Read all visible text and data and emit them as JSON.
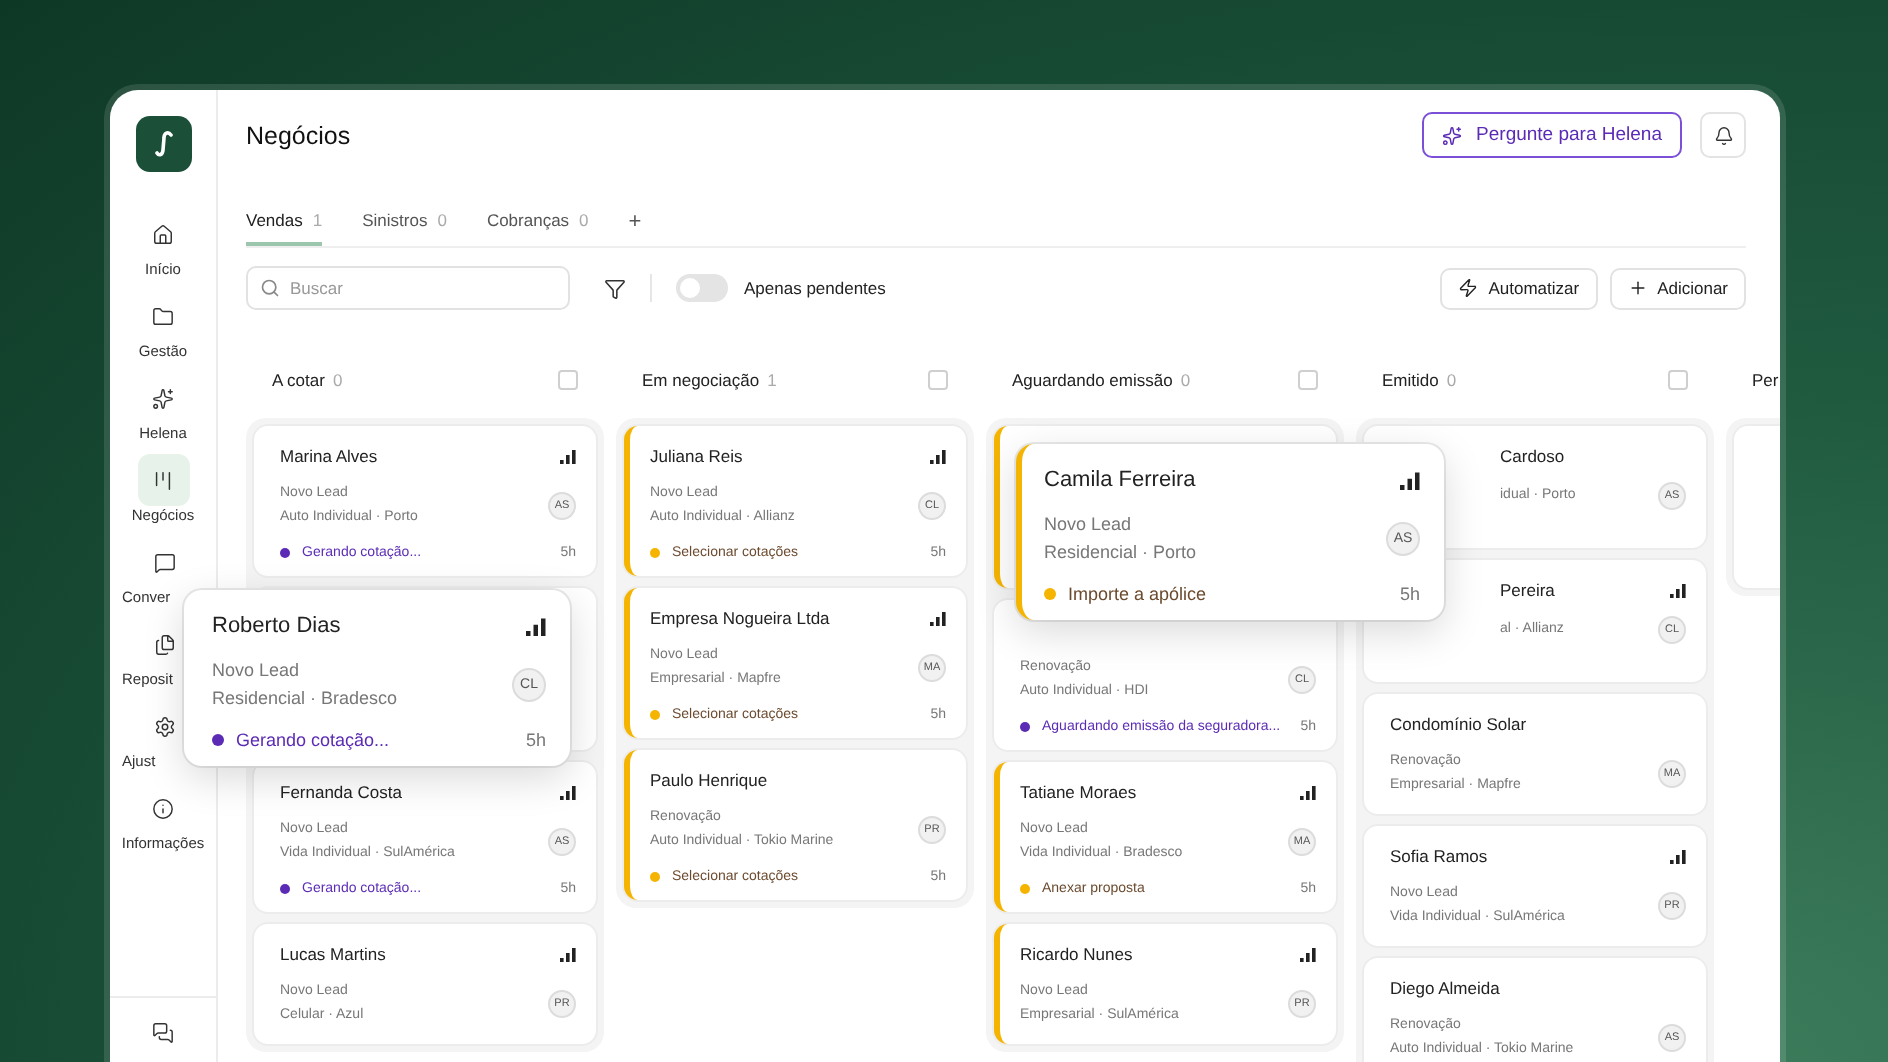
{
  "sidebar": {
    "items": [
      {
        "label": "Início",
        "kind": "nav",
        "selected": false
      },
      {
        "label": "Gestão",
        "kind": "nav",
        "selected": false
      },
      {
        "label": "Helena",
        "kind": "nav",
        "selected": false
      },
      {
        "label": "Negócios",
        "kind": "nav",
        "selected": true
      },
      {
        "label": "Conver",
        "kind": "clipped",
        "selected": false
      },
      {
        "label": "Reposit",
        "kind": "clipped",
        "selected": false
      },
      {
        "label": "Ajust",
        "kind": "clipped",
        "selected": false
      },
      {
        "label": "Informações",
        "kind": "nav",
        "selected": false
      }
    ]
  },
  "header": {
    "title": "Negócios",
    "ask_button": "Pergunte para Helena"
  },
  "tabs": [
    {
      "label": "Vendas",
      "count": "1",
      "selected": true
    },
    {
      "label": "Sinistros",
      "count": "0",
      "selected": false
    },
    {
      "label": "Cobranças",
      "count": "0",
      "selected": false
    }
  ],
  "add_tab": "+",
  "toolbar": {
    "search": {
      "placeholder": "Buscar"
    },
    "toggle": {
      "label": "Apenas pendentes",
      "on": false
    },
    "buttons": [
      "Automatizar",
      "Adicionar"
    ]
  },
  "columns": [
    {
      "title": "A cotar",
      "count": "0",
      "checked": false,
      "cards": [
        {
          "kind": "full",
          "accent": false,
          "name": "Marina Alves",
          "signal": true,
          "lines": [
            "Novo Lead",
            "Auto Individual · Porto"
          ],
          "avatar": "AS",
          "status": {
            "kind": "ai",
            "text": "Gerando cotação...",
            "color": "#5b2bb5"
          },
          "time": "5h"
        },
        {
          "kind": "covered"
        },
        {
          "kind": "full",
          "accent": false,
          "name": "Fernanda Costa",
          "signal": true,
          "lines": [
            "Novo Lead",
            "Vida Individual · SulAmérica"
          ],
          "avatar": "AS",
          "status": {
            "kind": "ai",
            "text": "Gerando cotação...",
            "color": "#5b2bb5"
          },
          "time": "5h"
        },
        {
          "kind": "full",
          "accent": false,
          "name": "Lucas Martins",
          "signal": true,
          "lines": [
            "Novo Lead",
            "Celular · Azul"
          ],
          "avatar": "PR"
        }
      ]
    },
    {
      "title": "Em negociação",
      "count": "1",
      "checked": false,
      "cards": [
        {
          "kind": "full",
          "accent": true,
          "name": "Juliana Reis",
          "signal": true,
          "lines": [
            "Novo Lead",
            "Auto Individual · Allianz"
          ],
          "avatar": "CL",
          "status": {
            "kind": "task",
            "text": "Selecionar cotações",
            "color": "#f5b400"
          },
          "time": "5h"
        },
        {
          "kind": "full",
          "accent": true,
          "name": "Empresa Nogueira Ltda",
          "signal": true,
          "lines": [
            "Novo Lead",
            "Empresarial · Mapfre"
          ],
          "avatar": "MA",
          "status": {
            "kind": "task",
            "text": "Selecionar cotações",
            "color": "#f5b400"
          },
          "time": "5h"
        },
        {
          "kind": "full",
          "accent": true,
          "name": "Paulo Henrique",
          "signal": false,
          "lines": [
            "Renovação",
            "Auto Individual · Tokio Marine"
          ],
          "avatar": "PR",
          "status": {
            "kind": "task",
            "text": "Selecionar cotações",
            "color": "#f5b400"
          },
          "time": "5h"
        }
      ]
    },
    {
      "title": "Aguardando emissão",
      "count": "0",
      "checked": false,
      "cards": [
        {
          "kind": "covered",
          "accent": true
        },
        {
          "kind": "full",
          "accent": false,
          "signal": false,
          "lines": [
            "Renovação",
            "Auto Individual · HDI"
          ],
          "avatar": "CL",
          "status": {
            "kind": "ai",
            "text": "Aguardando emissão da seguradora...",
            "color": "#5b2bb5"
          },
          "time": "5h"
        },
        {
          "kind": "full",
          "accent": true,
          "name": "Tatiane Moraes",
          "signal": true,
          "lines": [
            "Novo Lead",
            "Vida Individual · Bradesco"
          ],
          "avatar": "MA",
          "status": {
            "kind": "task",
            "text": "Anexar proposta",
            "color": "#f5b400"
          },
          "time": "5h"
        },
        {
          "kind": "full",
          "accent": true,
          "name": "Ricardo Nunes",
          "signal": true,
          "lines": [
            "Novo Lead",
            "Empresarial · SulAmérica"
          ],
          "avatar": "PR"
        }
      ]
    },
    {
      "title": "Emitido",
      "count": "0",
      "checked": false,
      "cards": [
        {
          "kind": "partial",
          "accent": false,
          "name": "Cardoso",
          "signal": false,
          "lines": [
            "idual · Porto"
          ],
          "avatar": "AS"
        },
        {
          "kind": "partial",
          "accent": false,
          "name": "Pereira",
          "signal": true,
          "lines": [
            "al · Allianz"
          ],
          "avatar": "CL"
        },
        {
          "kind": "full",
          "accent": false,
          "name": "Condomínio Solar",
          "signal": false,
          "lines": [
            "Renovação",
            "Empresarial · Mapfre"
          ],
          "avatar": "MA"
        },
        {
          "kind": "full",
          "accent": false,
          "name": "Sofia Ramos",
          "signal": true,
          "lines": [
            "Novo Lead",
            "Vida Individual · SulAmérica"
          ],
          "avatar": "PR"
        },
        {
          "kind": "full",
          "accent": false,
          "name": "Diego Almeida",
          "signal": false,
          "lines": [
            "Renovação",
            "Auto Individual · Tokio Marine"
          ],
          "avatar": "AS"
        }
      ]
    },
    {
      "title": "Per",
      "cards": [
        {
          "kind": "covered",
          "accent": false
        }
      ]
    }
  ],
  "dragged_cards": [
    {
      "accent": false,
      "name": "Roberto Dias",
      "signal": true,
      "lines": [
        "Novo Lead",
        "Residencial · Bradesco"
      ],
      "avatar": "CL",
      "status": {
        "kind": "ai",
        "text": "Gerando cotação...",
        "color": "#5b2bb5"
      },
      "time": "5h"
    },
    {
      "accent": true,
      "name": "Camila Ferreira",
      "signal": true,
      "lines": [
        "Novo Lead",
        "Residencial · Porto"
      ],
      "avatar": "AS",
      "status": {
        "kind": "task",
        "text": "Importe a apólice",
        "color": "#f5b400"
      },
      "time": "5h"
    }
  ]
}
